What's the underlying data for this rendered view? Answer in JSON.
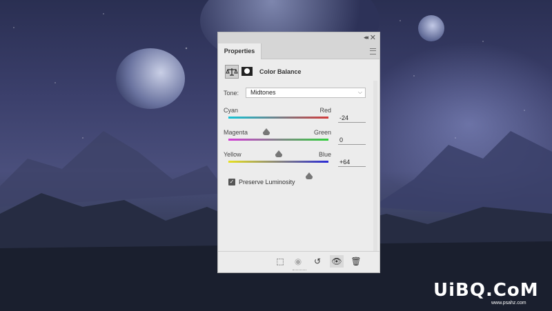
{
  "panel": {
    "tab_label": "Properties",
    "title": "Color Balance",
    "tone": {
      "label": "Tone:",
      "value": "Midtones"
    },
    "sliders": [
      {
        "left": "Cyan",
        "right": "Red",
        "value": "-24",
        "fraction": 0.38,
        "gradient": [
          "#12c4d6",
          "#d43a3a"
        ]
      },
      {
        "left": "Magenta",
        "right": "Green",
        "value": "0",
        "fraction": 0.5,
        "gradient": [
          "#d33ad6",
          "#2fcf3a"
        ]
      },
      {
        "left": "Yellow",
        "right": "Blue",
        "value": "+64",
        "fraction": 0.81,
        "gradient": [
          "#e6e020",
          "#2a2ad6"
        ]
      }
    ],
    "preserve_luminosity": {
      "label": "Preserve Luminosity",
      "checked": true
    }
  },
  "watermark": {
    "text": "UiBQ.CoM",
    "sub": "www.psahz.com"
  }
}
